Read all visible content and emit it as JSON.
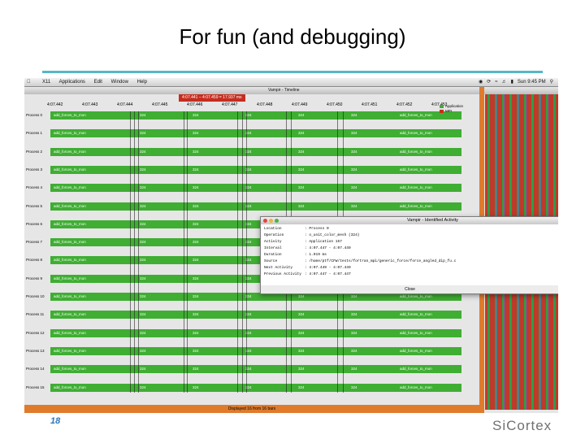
{
  "slide": {
    "title": "For fun (and debugging)",
    "page_number": "18",
    "logo_text": "SiCortex"
  },
  "menubar": {
    "items": [
      "X11",
      "Applications",
      "Edit",
      "Window",
      "Help"
    ],
    "clock": "Sun 9:45 PM"
  },
  "timeline_window": {
    "title": "Vampir - Timeline",
    "zoom_info": "4:07.441 – 4:07.459 = 17.937 ms",
    "ticks": [
      "4:07.442",
      "4:07.443",
      "4:07.444",
      "4:07.445",
      "4:07.446",
      "4:07.447",
      "4:07.448",
      "4:07.449",
      "4:07.450",
      "4:07.451",
      "4:07.452",
      "4:07.453"
    ],
    "legend": [
      {
        "label": "Application",
        "color": "#3fae33"
      },
      {
        "label": "MPI",
        "color": "#c62d1f"
      }
    ],
    "status": "Displayed 16 from 16 bars",
    "processes": [
      {
        "label": "Process 0",
        "start": "add_forces_to_mon",
        "mid": "324",
        "end": "add_forces_to_mon"
      },
      {
        "label": "Process 1",
        "start": "add_forces_to_mon",
        "mid": "324",
        "end": "add_forces_to_mon"
      },
      {
        "label": "Process 2",
        "start": "add_forces_to_mon",
        "mid": "324",
        "end": "add_forces_to_mon"
      },
      {
        "label": "Process 3",
        "start": "add_forces_to_mon",
        "mid": "324",
        "end": "add_forces_to_mon"
      },
      {
        "label": "Process 4",
        "start": "add_forces_to_mon",
        "mid": "324",
        "end": "add_forces_to_mon"
      },
      {
        "label": "Process 5",
        "start": "add_forces_to_mon",
        "mid": "324",
        "end": "add_forces_to_mon"
      },
      {
        "label": "Process 6",
        "start": "add_forces_to_mon",
        "mid": "324",
        "end": "add_forces_to_mon"
      },
      {
        "label": "Process 7",
        "start": "add_forces_to_mon",
        "mid": "324",
        "end": "add_forces_to_mon"
      },
      {
        "label": "Process 8",
        "start": "add_forces_to_mon",
        "mid": "324",
        "end": "add_forces_to_mon"
      },
      {
        "label": "Process 9",
        "start": "add_forces_to_mon",
        "mid": "324",
        "end": "add_forces_to_mon"
      },
      {
        "label": "Process 10",
        "start": "add_forces_to_mon",
        "mid": "324",
        "end": "add_forces_to_mon"
      },
      {
        "label": "Process 11",
        "start": "add_forces_to_mon",
        "mid": "324",
        "end": "add_forces_to_mon"
      },
      {
        "label": "Process 12",
        "start": "add_forces_to_mon",
        "mid": "324",
        "end": "add_forces_to_mon"
      },
      {
        "label": "Process 13",
        "start": "add_forces_to_mon",
        "mid": "324",
        "end": "add_forces_to_mon"
      },
      {
        "label": "Process 14",
        "start": "add_forces_to_mon",
        "mid": "324",
        "end": "add_forces_to_mon"
      },
      {
        "label": "Process 15",
        "start": "add_forces_to_mon",
        "mid": "324",
        "end": "add_forces_to_mon"
      }
    ]
  },
  "activity_dialog": {
    "title": "Vampir - Identified Activity",
    "rows": [
      {
        "key": "Location",
        "value": ": Process 0"
      },
      {
        "key": "Operation",
        "value": ": o_unit_color_mesh (324)"
      },
      {
        "key": "Activity",
        "value": ": Application 157"
      },
      {
        "key": "Interval",
        "value": ": 4:07.447 - 4:07.449"
      },
      {
        "key": "Duration",
        "value": ": 1.919 ms"
      },
      {
        "key": "Source",
        "value": ": /home/ptf/CFW/tests/fortran_mpi/generic_force/force_angled_dip_fu.c"
      },
      {
        "key": "Next Activity",
        "value": ": 4:07.449 - 4:07.449"
      },
      {
        "key": "Previous Activity",
        "value": ": 4:07.447 - 4:07.447"
      }
    ],
    "close_label": "Close"
  },
  "colors": {
    "title_rule": "#55b7c9",
    "app_green": "#3fae33",
    "mpi_red": "#c62d1f",
    "frame_orange": "#e07b2c",
    "page_number": "#2e79b8"
  }
}
